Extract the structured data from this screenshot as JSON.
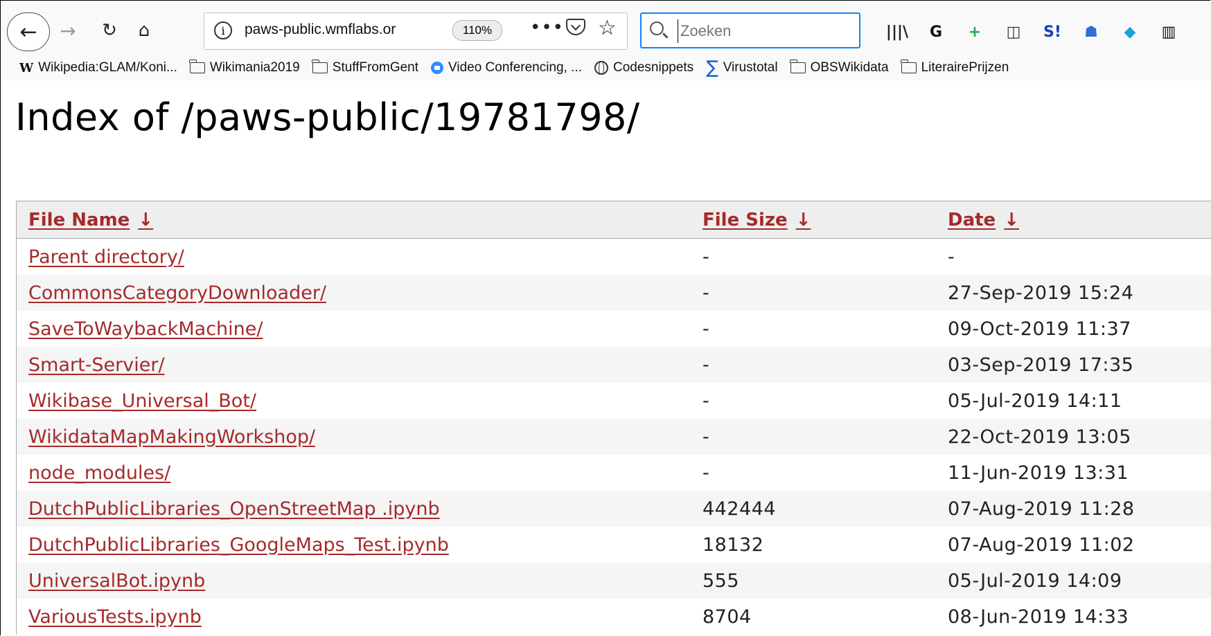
{
  "browser": {
    "url": "paws-public.wmflabs.or",
    "zoom": "110%",
    "page_actions": "•••",
    "search_placeholder": "Zoeken",
    "toolbar_icons": [
      {
        "name": "library-icon",
        "glyph": "|||\\",
        "color": "#222222"
      },
      {
        "name": "extension-g-icon",
        "glyph": "G",
        "color": "#111111"
      },
      {
        "name": "extension-plus-icon",
        "glyph": "+",
        "color": "#2fa84f"
      },
      {
        "name": "sidebar-icon",
        "glyph": "◫",
        "color": "#333333"
      },
      {
        "name": "extension-s-icon",
        "glyph": "S!",
        "color": "#1a3fb8"
      },
      {
        "name": "ghostery-icon",
        "glyph": "☗",
        "color": "#2d6fd6"
      },
      {
        "name": "extension-cube-icon",
        "glyph": "◆",
        "color": "#1aa0e0"
      },
      {
        "name": "extension-box-icon",
        "glyph": "▥",
        "color": "#111111"
      }
    ]
  },
  "bookmarks": [
    {
      "label": "Wikipedia:GLAM/Koni...",
      "icon": "wikipedia-icon"
    },
    {
      "label": "Wikimania2019",
      "icon": "folder-icon"
    },
    {
      "label": "StuffFromGent",
      "icon": "folder-icon"
    },
    {
      "label": "Video Conferencing, ...",
      "icon": "zoom-icon"
    },
    {
      "label": "Codesnippets",
      "icon": "globe-icon"
    },
    {
      "label": "Virustotal",
      "icon": "virustotal-icon"
    },
    {
      "label": "OBSWikidata",
      "icon": "folder-icon"
    },
    {
      "label": "LiterairePrijzen",
      "icon": "folder-icon"
    }
  ],
  "page": {
    "title": "Index of /paws-public/19781798/",
    "columns": {
      "name": "File Name",
      "size": "File Size",
      "date": "Date",
      "sort_glyph": "↓"
    },
    "rows": [
      {
        "name": "Parent directory/",
        "size": "-",
        "date": "-"
      },
      {
        "name": "CommonsCategoryDownloader/",
        "size": "-",
        "date": "27-Sep-2019 15:24"
      },
      {
        "name": "SaveToWaybackMachine/",
        "size": "-",
        "date": "09-Oct-2019 11:37"
      },
      {
        "name": "Smart-Servier/",
        "size": "-",
        "date": "03-Sep-2019 17:35"
      },
      {
        "name": "Wikibase_Universal_Bot/",
        "size": "-",
        "date": "05-Jul-2019 14:11"
      },
      {
        "name": "WikidataMapMakingWorkshop/",
        "size": "-",
        "date": "22-Oct-2019 13:05"
      },
      {
        "name": "node_modules/",
        "size": "-",
        "date": "11-Jun-2019 13:31"
      },
      {
        "name": "DutchPublicLibraries_OpenStreetMap .ipynb",
        "size": "442444",
        "date": "07-Aug-2019 11:28"
      },
      {
        "name": "DutchPublicLibraries_GoogleMaps_Test.ipynb",
        "size": "18132",
        "date": "07-Aug-2019 11:02"
      },
      {
        "name": "UniversalBot.ipynb",
        "size": "555",
        "date": "05-Jul-2019 14:09"
      },
      {
        "name": "VariousTests.ipynb",
        "size": "8704",
        "date": "08-Jun-2019 14:33"
      }
    ]
  },
  "colors": {
    "link": "#a52a2a",
    "search_focus": "#0a84ff"
  }
}
